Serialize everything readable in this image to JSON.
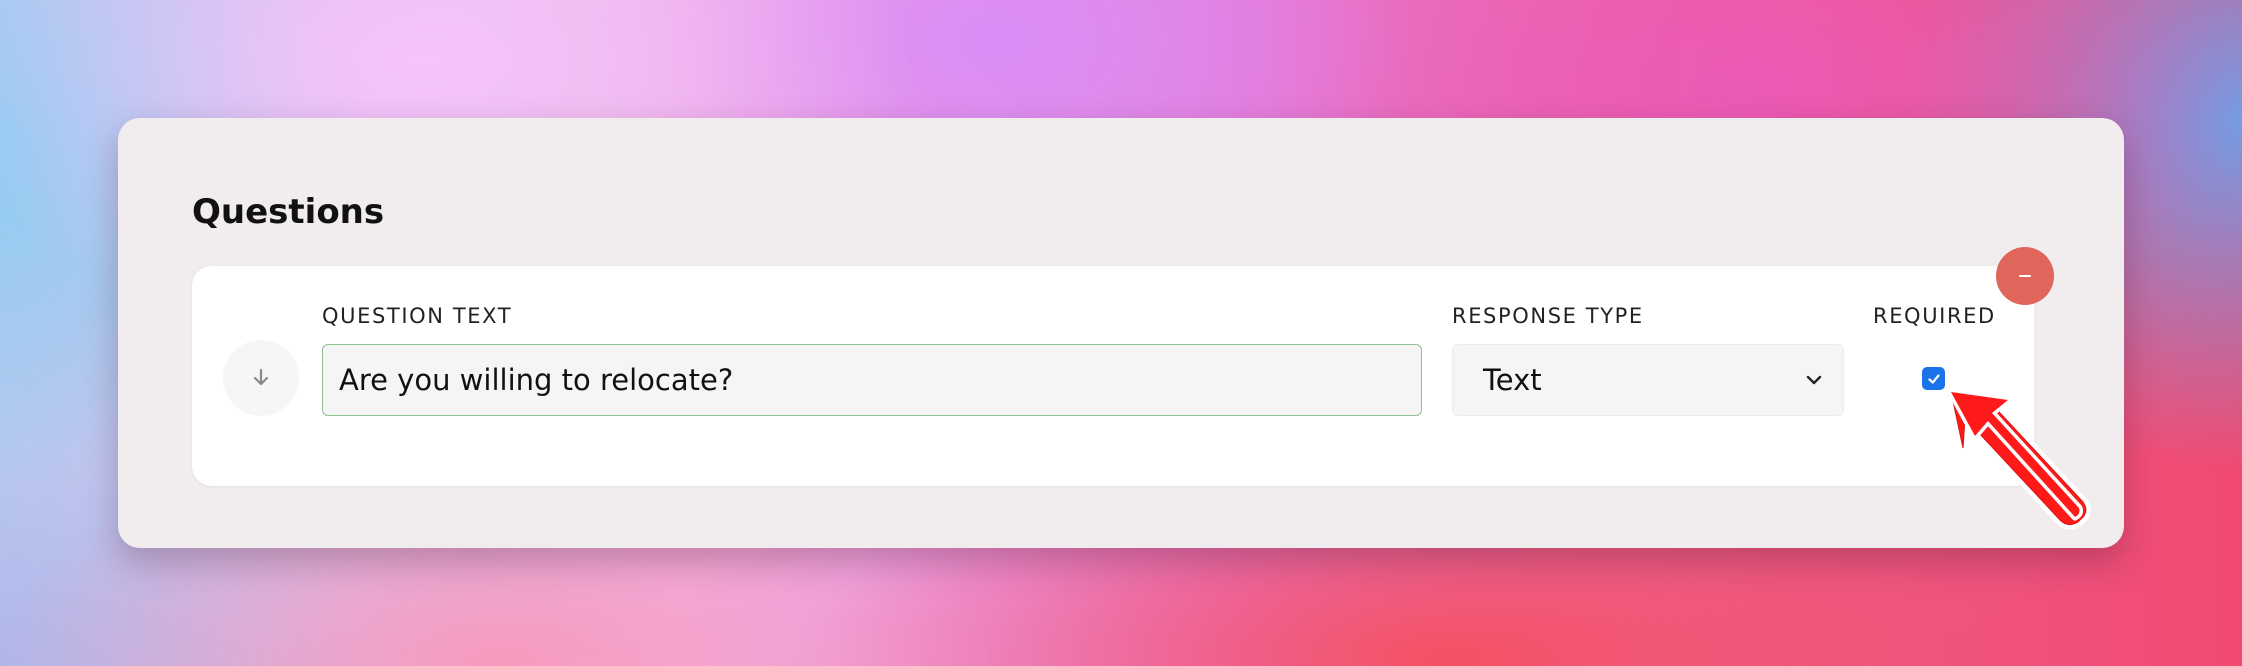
{
  "section": {
    "title": "Questions"
  },
  "question": {
    "question_text_label": "QUESTION TEXT",
    "question_text_value": "Are you willing to relocate?",
    "response_type_label": "RESPONSE TYPE",
    "response_type_value": "Text",
    "required_label": "REQUIRED",
    "required_checked": true
  },
  "icons": {
    "remove": "minus-icon",
    "drag": "arrow-down-icon",
    "select": "chevron-down-icon",
    "checkbox": "checkmark-icon",
    "annotation": "red-arrow-icon"
  },
  "colors": {
    "remove_button": "#e0665c",
    "checkbox": "#1a73e8",
    "input_border": "#90c090",
    "annotation_arrow": "#ff1a1a"
  }
}
